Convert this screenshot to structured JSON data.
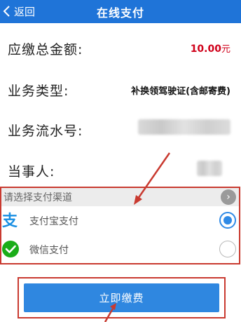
{
  "header": {
    "back_label": "返回",
    "title": "在线支付"
  },
  "info": {
    "amount_label": "应缴总金额:",
    "amount_value": "10.00",
    "amount_unit": "元",
    "biz_type_label": "业务类型:",
    "biz_type_value": "补换领驾驶证(含邮寄费)",
    "serial_label": "业务流水号:",
    "party_label": "当事人:"
  },
  "channel": {
    "header": "请选择支付渠道",
    "options": [
      {
        "label": "支付宝支付",
        "icon": "alipay-icon",
        "selected": true,
        "color": "#1a8fe3"
      },
      {
        "label": "微信支付",
        "icon": "wechat-pay-icon",
        "selected": false,
        "color": "#1aad19"
      }
    ]
  },
  "pay_button": "立即缴费",
  "colors": {
    "header_bg": "#1f74d8",
    "amount": "#d0021b",
    "button_bg": "#2f87e0",
    "annotation": "#c93a30"
  }
}
